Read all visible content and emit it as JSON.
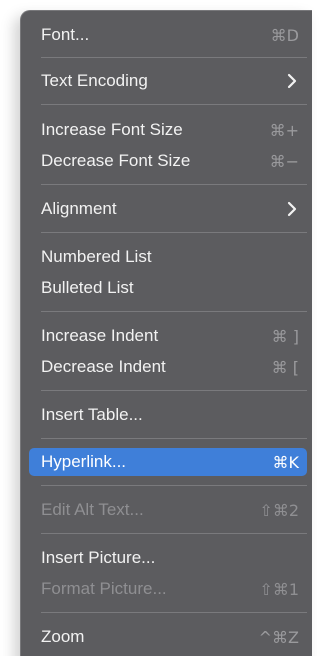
{
  "menu": {
    "items": [
      {
        "label": "Font...",
        "shortcut": "⌘D"
      },
      {
        "label": "Text Encoding",
        "submenu_icon": "chevron-right-icon"
      },
      {
        "label": "Increase Font Size",
        "shortcut": "⌘+"
      },
      {
        "label": "Decrease Font Size",
        "shortcut": "⌘−"
      },
      {
        "label": "Alignment",
        "submenu_icon": "chevron-right-icon"
      },
      {
        "label": "Numbered List"
      },
      {
        "label": "Bulleted List"
      },
      {
        "label": "Increase Indent",
        "shortcut": "⌘ ]"
      },
      {
        "label": "Decrease Indent",
        "shortcut": "⌘ ["
      },
      {
        "label": "Insert Table..."
      },
      {
        "label": "Hyperlink...",
        "shortcut": "⌘K",
        "state": "highlighted"
      },
      {
        "label": "Edit Alt Text...",
        "shortcut": "⇧⌘2",
        "state": "disabled"
      },
      {
        "label": "Insert Picture..."
      },
      {
        "label": "Format Picture...",
        "shortcut": "⇧⌘1",
        "state": "disabled"
      },
      {
        "label": "Zoom",
        "shortcut": "^⌘Z"
      }
    ]
  },
  "colors": {
    "menu_background": "#5c5c5f",
    "highlight": "#3f7fd9",
    "text": "#f2f2f2",
    "disabled_text": "#8f8f92",
    "shortcut_text": "#9a9a9d",
    "separator": "#7a7a7d"
  }
}
